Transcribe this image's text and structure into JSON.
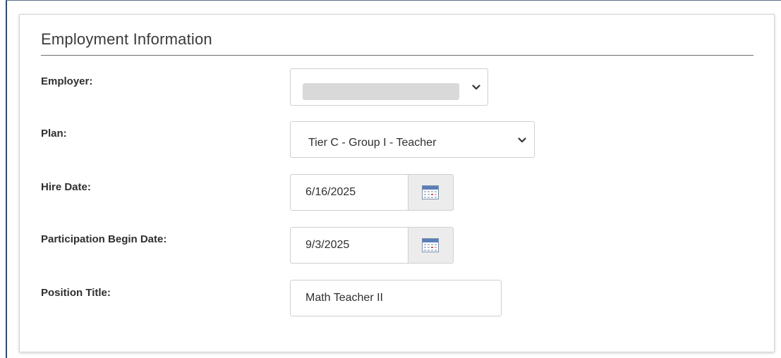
{
  "section": {
    "title": "Employment Information"
  },
  "fields": {
    "employer": {
      "label": "Employer:"
    },
    "plan": {
      "label": "Plan:",
      "value": "Tier C - Group I - Teacher"
    },
    "hire_date": {
      "label": "Hire Date:",
      "value": "6/16/2025"
    },
    "participation_begin_date": {
      "label": "Participation Begin Date:",
      "value": "9/3/2025"
    },
    "position_title": {
      "label": "Position Title:",
      "value": "Math Teacher II"
    }
  },
  "icons": {
    "select_arrow": "chevron-down-icon",
    "date_picker": "calendar-icon"
  }
}
